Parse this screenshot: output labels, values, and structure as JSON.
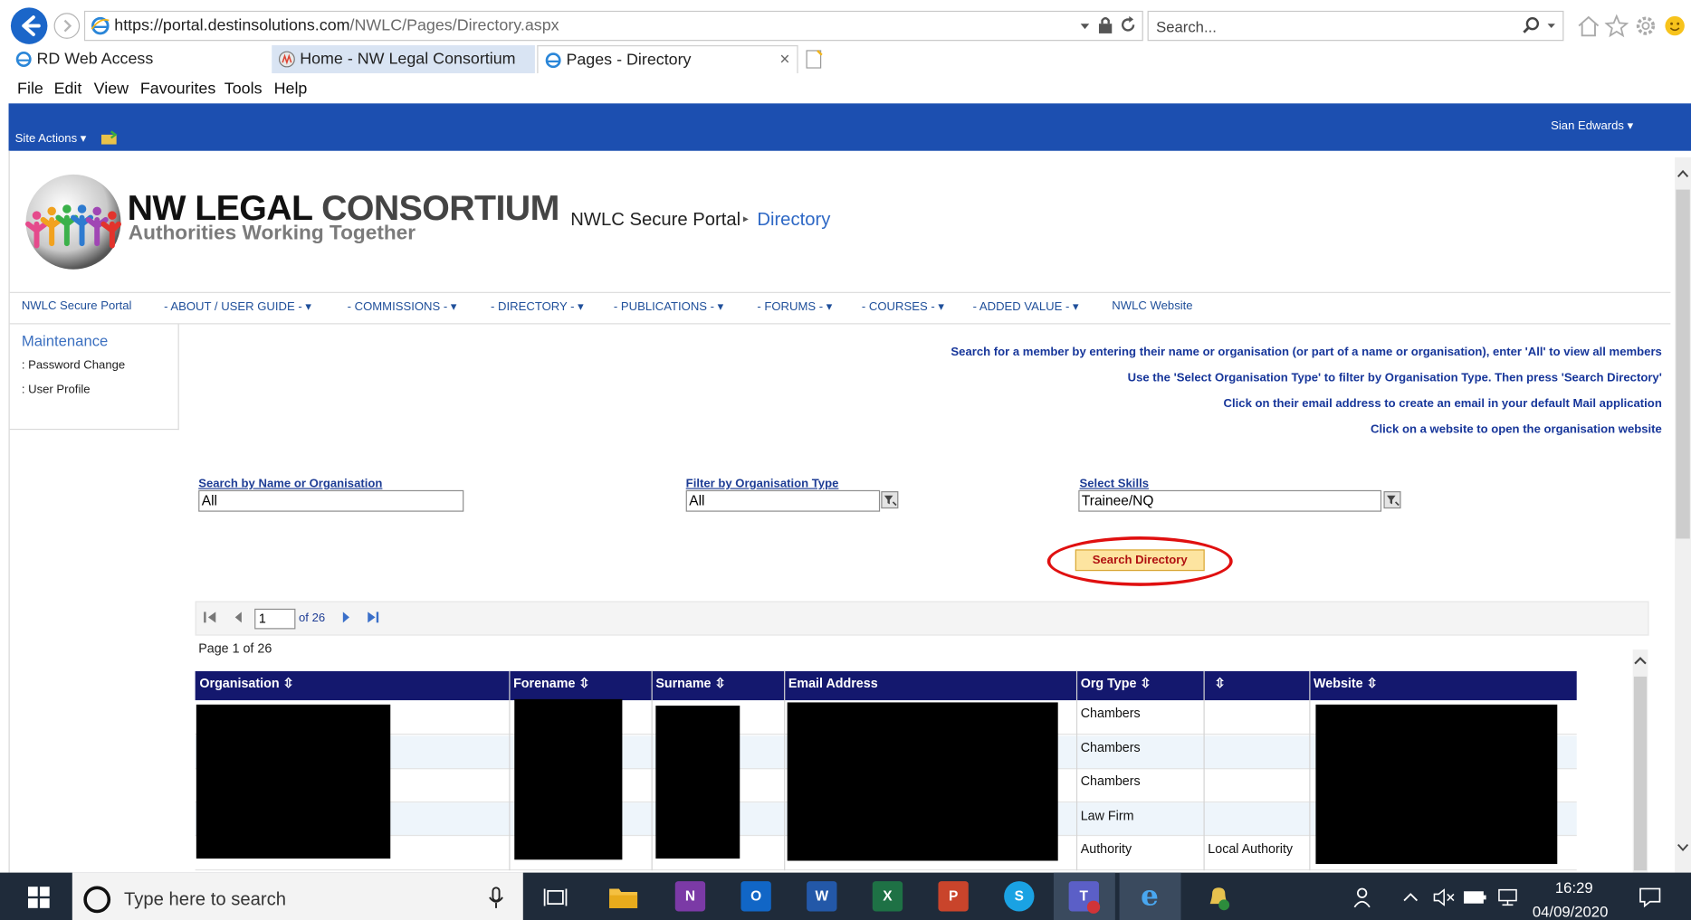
{
  "browser": {
    "url_prefix": "https://portal.",
    "url_domain": "destinsolutions.com",
    "url_path": "/NWLC/Pages/Directory.aspx",
    "search_placeholder": "Search...",
    "tabs": [
      {
        "label": "RD Web Access",
        "active": false
      },
      {
        "label": "Home - NW Legal Consortium",
        "active": false
      },
      {
        "label": "Pages - Directory",
        "active": true
      }
    ],
    "close_glyph": "×",
    "menu": [
      "File",
      "Edit",
      "View",
      "Favourites",
      "Tools",
      "Help"
    ]
  },
  "ribbon": {
    "site_actions": "Site Actions",
    "user": "Sian Edwards"
  },
  "logo": {
    "title_a": "NW LEGAL ",
    "title_b": "CONSORTIUM",
    "subtitle": "Authorities Working Together"
  },
  "breadcrumb": {
    "root": "NWLC Secure Portal",
    "separator": "▸",
    "current": "Directory"
  },
  "topnav": [
    "NWLC Secure Portal",
    "- ABOUT / USER GUIDE -",
    "- COMMISSIONS -",
    "- DIRECTORY -",
    "- PUBLICATIONS -",
    "- FORUMS -",
    "- COURSES -",
    "- ADDED VALUE -",
    "NWLC Website"
  ],
  "leftnav": {
    "title": "Maintenance",
    "items": [
      ": Password Change",
      ": User Profile"
    ]
  },
  "instructions": [
    "Search for a member by entering their name or organisation (or part of a name or organisation), enter 'All' to view all members",
    "Use the 'Select Organisation Type' to filter by Organisation Type. Then press 'Search Directory'",
    "Click on their email address to create an email in your default Mail application",
    "Click on a website to open the organisation website"
  ],
  "filters": {
    "name_label": "Search by Name or Organisation",
    "name_value": "All",
    "org_label": "Filter by Organisation Type",
    "org_value": "All",
    "skills_label": "Select Skills",
    "skills_value": "Trainee/NQ"
  },
  "search_button": "Search Directory",
  "pager": {
    "current": "1",
    "of_label": "of 26",
    "page_label": "Page 1 of 26"
  },
  "grid": {
    "columns": [
      "Organisation",
      "Forename",
      "Surname",
      "Email Address",
      "Org Type",
      "",
      "Website"
    ],
    "rows": [
      {
        "org_type": "Chambers",
        "extra": ""
      },
      {
        "org_type": "Chambers",
        "extra": ""
      },
      {
        "org_type": "Chambers",
        "extra": ""
      },
      {
        "org_type": "Law Firm",
        "extra": ""
      },
      {
        "org_type": "Authority",
        "extra": "Local Authority"
      }
    ]
  },
  "taskbar": {
    "search_placeholder": "Type here to search",
    "apps": [
      {
        "label": "N",
        "color": "#7b3aa6"
      },
      {
        "label": "O",
        "color": "#1166c6"
      },
      {
        "label": "W",
        "color": "#2358a8"
      },
      {
        "label": "X",
        "color": "#1e7145"
      },
      {
        "label": "P",
        "color": "#c9442b"
      },
      {
        "label": "S",
        "color": "#1aa2e3"
      },
      {
        "label": "T",
        "color": "#5b5fc7"
      },
      {
        "label": "e",
        "color": "#1c86d8"
      }
    ],
    "time": "16:29",
    "date": "04/09/2020"
  },
  "colors": {
    "ribbon": "#1c4fb0",
    "grid_header": "#14186e",
    "link": "#1f4f9a",
    "highlight_ring": "#e01010"
  }
}
